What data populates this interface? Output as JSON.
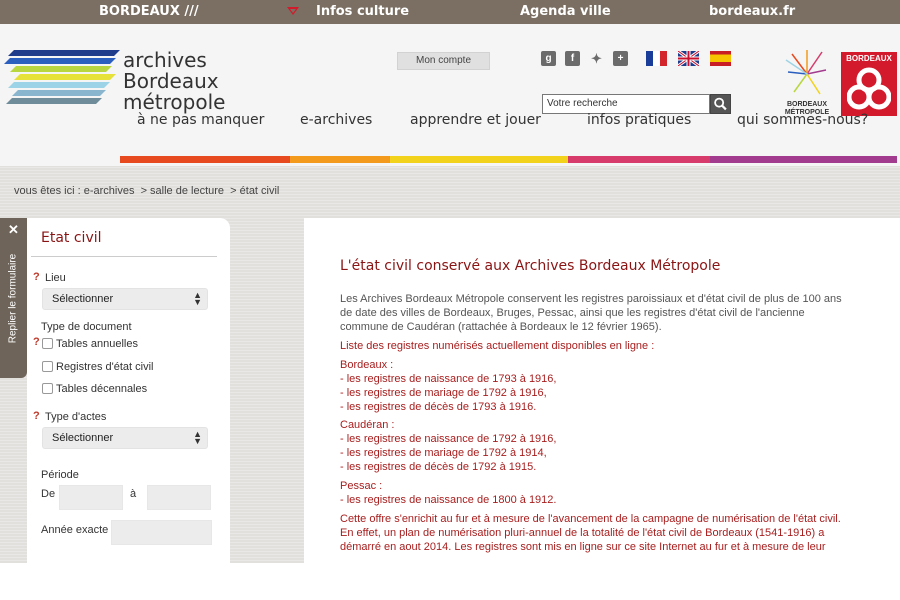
{
  "topbar": {
    "brand": "BORDEAUX ///",
    "culture": "Infos culture",
    "agenda": "Agenda ville",
    "site": "bordeaux.fr"
  },
  "logo": {
    "line1": "archives",
    "line2": "Bordeaux",
    "line3": "métropole"
  },
  "header": {
    "account_label": "Mon compte",
    "search_placeholder": "Votre recherche",
    "metro_label_1": "BORDEAUX",
    "metro_label_2": "MÉTROPOLE",
    "bdx_label": "BORDEAUX"
  },
  "nav": {
    "items": [
      {
        "label": "à ne pas manquer",
        "color": "#e84a1f"
      },
      {
        "label": "e-archives",
        "color": "#f39a1c"
      },
      {
        "label": "apprendre et jouer",
        "color": "#f2d21a"
      },
      {
        "label": "infos pratiques",
        "color": "#d63b6c"
      },
      {
        "label": "qui sommes-nous?",
        "color": "#a23a8d"
      }
    ]
  },
  "breadcrumb": {
    "prefix": "vous êtes ici : ",
    "item1": "e-archives",
    "item2": "salle de lecture",
    "item3": "état civil"
  },
  "form": {
    "tab_label": "Replier le formulaire",
    "close": "✕",
    "title": "Etat civil",
    "lieu_label": "Lieu",
    "lieu_value": "Sélectionner",
    "doc_type_label": "Type de document",
    "checkbox_1": "Tables annuelles",
    "checkbox_2": "Registres d'état civil",
    "checkbox_3": "Tables décennales",
    "acte_label": "Type d'actes",
    "acte_value": "Sélectionner",
    "period_label": "Période",
    "from_label": "De",
    "to_label": "à",
    "exact_year_label": "Année exacte",
    "help_mark": "?"
  },
  "main": {
    "title": "L'état civil conservé aux Archives Bordeaux Métropole",
    "intro": [
      "Les Archives Bordeaux Métropole conservent les registres paroissiaux et d'état civil de plus de 100 ans",
      "de date des villes de Bordeaux, Bruges, Pessac, ainsi que les registres d'état civil de l'ancienne",
      "commune de Caudéran (rattachée à Bordeaux le 12 février 1965)."
    ],
    "list_heading": "Liste des registres numérisés actuellement disponibles en ligne :",
    "bordeaux": {
      "city": "Bordeaux :",
      "items": [
        "- les registres de naissance de 1793 à 1916,",
        "- les registres de mariage de 1792 à 1916,",
        "- les registres de décès de 1793 à 1916."
      ]
    },
    "cauderan": {
      "city": "Caudéran :",
      "items": [
        "- les registres de naissance de 1792 à 1916,",
        "- les registres de mariage de 1792 à 1914,",
        "- les registres de décès de 1792 à 1915."
      ]
    },
    "pessac": {
      "city": "Pessac :",
      "items": [
        "- les registres de naissance de 1800 à 1912."
      ]
    },
    "closing": [
      "Cette offre s'enrichit au fur et à mesure de l'avancement de la campagne de numérisation de l'état civil.",
      "En effet, un plan de numérisation pluri-annuel de la totalité de l'état civil de Bordeaux (1541-1916) a",
      "démarré en aout 2014. Les registres sont mis en ligne sur ce site Internet au fur et à mesure de leur"
    ]
  }
}
